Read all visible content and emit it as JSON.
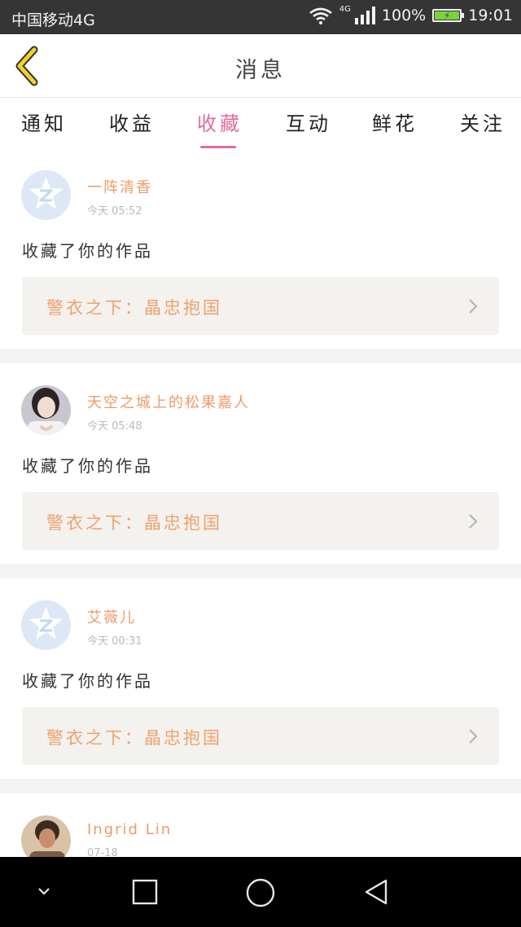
{
  "status_bar": {
    "carrier": "中国移动4G",
    "network": "4G",
    "battery": "100%",
    "time": "19:01",
    "battery_level": 1.0
  },
  "header": {
    "title": "消息",
    "back_icon": "chevron-left-icon"
  },
  "tabs": [
    {
      "label": "通知",
      "active": false
    },
    {
      "label": "收益",
      "active": false
    },
    {
      "label": "收藏",
      "active": true
    },
    {
      "label": "互动",
      "active": false
    },
    {
      "label": "鲜花",
      "active": false
    },
    {
      "label": "关注",
      "active": false
    }
  ],
  "items": [
    {
      "name": "一阵清香",
      "time": "今天 05:52",
      "action": "收藏了你的作品",
      "work": "警衣之下：晶忠抱国",
      "avatar": "default-avatar-icon"
    },
    {
      "name": "天空之城上的松果嘉人",
      "time": "今天 05:48",
      "action": "收藏了你的作品",
      "work": "警衣之下：晶忠抱国",
      "avatar": "user-photo-avatar"
    },
    {
      "name": "艾薇儿",
      "time": "今天 00:31",
      "action": "收藏了你的作品",
      "work": "警衣之下：晶忠抱国",
      "avatar": "default-avatar-icon"
    },
    {
      "name": "Ingrid Lin",
      "time": "07-18",
      "avatar": "user-photo-avatar"
    }
  ],
  "colors": {
    "accent": "#e06c9f",
    "username": "#ee9b6a",
    "work_title": "#f0a06c",
    "back_icon": "#f2d22a"
  }
}
